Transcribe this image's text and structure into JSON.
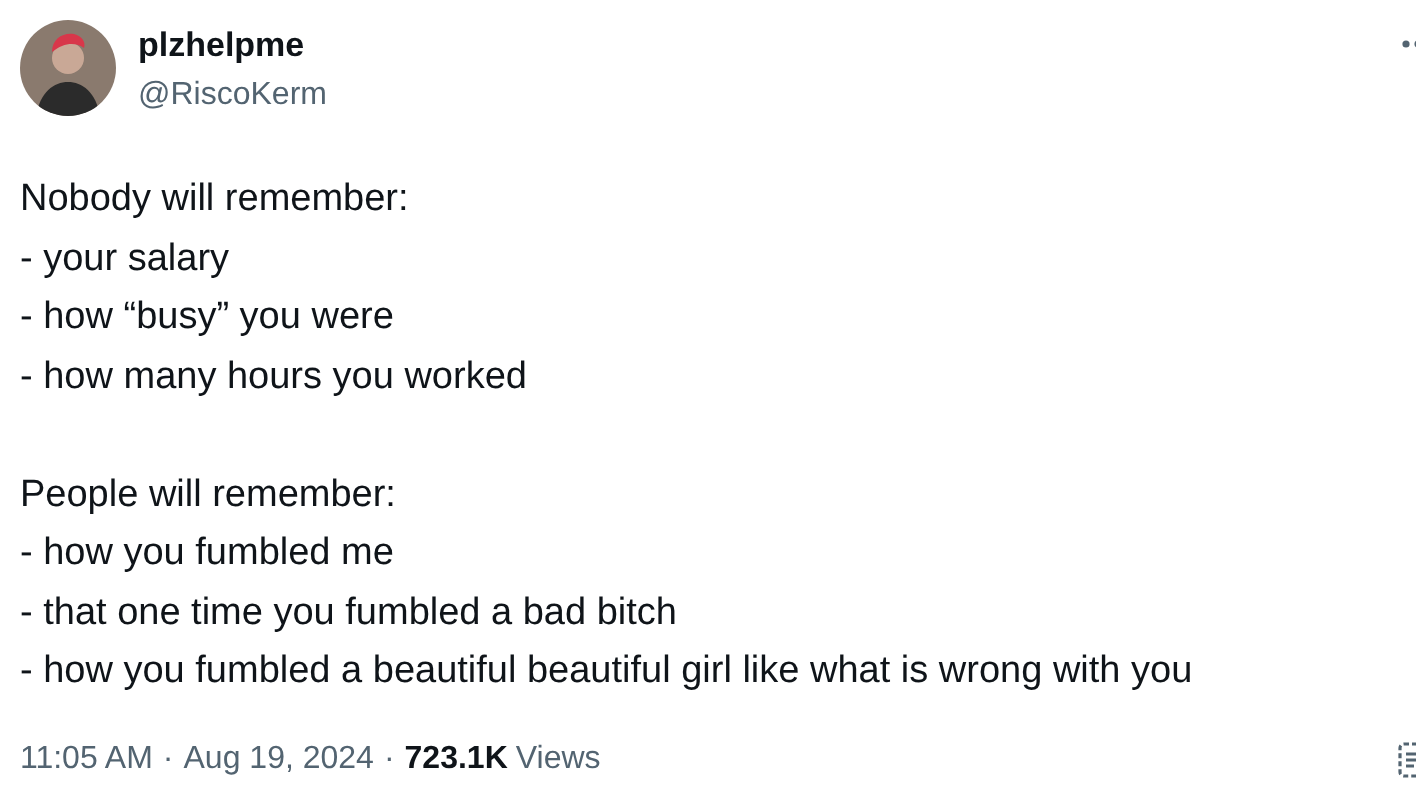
{
  "author": {
    "name": "plzhelpme",
    "handle": "@RiscoKerm"
  },
  "body": [
    {
      "lines": [
        "Nobody will remember:",
        "- your salary",
        "- how “busy” you were",
        "- how many hours you worked"
      ]
    },
    {
      "lines": [
        "People will remember:",
        "- how you fumbled me",
        "- that one time you fumbled a bad bitch",
        "- how you fumbled a beautiful beautiful girl like what is wrong with you"
      ]
    }
  ],
  "meta": {
    "time": "11:05 AM",
    "date": "Aug 19, 2024",
    "separator": "·",
    "views_count": "723.1K",
    "views_label": "Views"
  }
}
